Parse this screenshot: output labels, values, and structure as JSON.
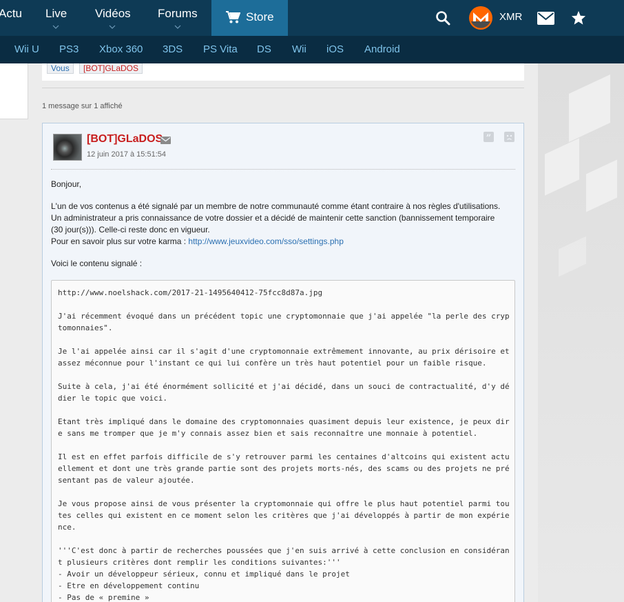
{
  "nav": {
    "actu": "Actu",
    "live": "Live",
    "videos": "Vidéos",
    "forums": "Forums",
    "store": "Store",
    "xmr": "XMR"
  },
  "platforms": [
    "Wii U",
    "PS3",
    "Xbox 360",
    "3DS",
    "PS Vita",
    "DS",
    "Wii",
    "iOS",
    "Android"
  ],
  "tags": {
    "vous": "Vous",
    "bot": "[BOT]GLaDOS"
  },
  "count_text": "1 message sur 1 affiché",
  "message": {
    "author": "[BOT]GLaDOS",
    "date": "12 juin 2017 à 15:51:54",
    "greeting": "Bonjour,",
    "para1_line1": "L'un de vos contenus a été signalé par un membre de notre communauté comme étant contraire à nos règles d'utilisations.",
    "para1_line2": "Un administrateur a pris connaissance de votre dossier et a décidé de maintenir cette sanction (bannissement temporaire",
    "para1_line3": "(30 jour(s))). Celle-ci reste donc en vigueur.",
    "para1_line4_prefix": "Pour en savoir plus sur votre karma : ",
    "karma_link": "http://www.jeuxvideo.com/sso/settings.php",
    "reported_intro": "Voici le contenu signalé :",
    "code_lines": [
      "http://www.noelshack.com/2017-21-1495640412-75fcc8d87a.jpg",
      "",
      "J'ai récemment évoqué dans un précédent topic une cryptomonnaie que j'ai appelée \"la perle des cryp",
      "tomonnaies\".",
      "",
      "Je l'ai appelée ainsi car il s'agit d'une cryptomonnaie extrêmement innovante, au prix dérisoire et",
      "assez méconnue pour l'instant ce qui lui confère un très haut potentiel pour un faible risque.",
      "",
      "Suite à cela, j'ai été énormément sollicité et j'ai décidé, dans un souci de contractualité, d'y dé",
      "dier le topic que voici.",
      "",
      "Etant très impliqué dans le domaine des cryptomonnaies quasiment depuis leur existence, je peux dir",
      "e sans me tromper que je m'y connais assez bien et sais reconnaître une monnaie à potentiel.",
      "",
      "Il est en effet parfois difficile de s'y retrouver parmi les centaines d'altcoins qui existent actu",
      "ellement et dont une très grande partie sont des projets morts-nés, des scams ou des projets ne pré",
      "sentant pas de valeur ajoutée.",
      "",
      "Je vous propose ainsi de vous présenter la cryptomonnaie qui offre le plus haut potentiel parmi tou",
      "tes celles qui existent en ce moment selon les critères que j'ai développés à partir de mon expérie",
      "nce.",
      "",
      "'''C'est donc à partir de recherches poussées que j'en suis arrivé à cette conclusion en considéran",
      "t plusieurs critères dont remplir les conditions suivantes:'''",
      "- Avoir un développeur sérieux, connu et impliqué dans le projet",
      "- Etre en développement continu",
      "- Pas de « premine »"
    ]
  },
  "colors": {
    "nav_bg": "#0e3a55",
    "store_bg": "#1d6d99",
    "platbar_bg": "#0a2c42",
    "platform_text": "#7fc3ea",
    "author_red": "#c81e1e",
    "link_blue": "#2a6fb1",
    "monero_orange": "#ff6600"
  },
  "icons": [
    "cart-icon",
    "search-icon",
    "monero-logo",
    "mail-icon",
    "star-icon",
    "chevron-down-icon",
    "private-message-icon",
    "quote-icon",
    "alert-icon"
  ]
}
